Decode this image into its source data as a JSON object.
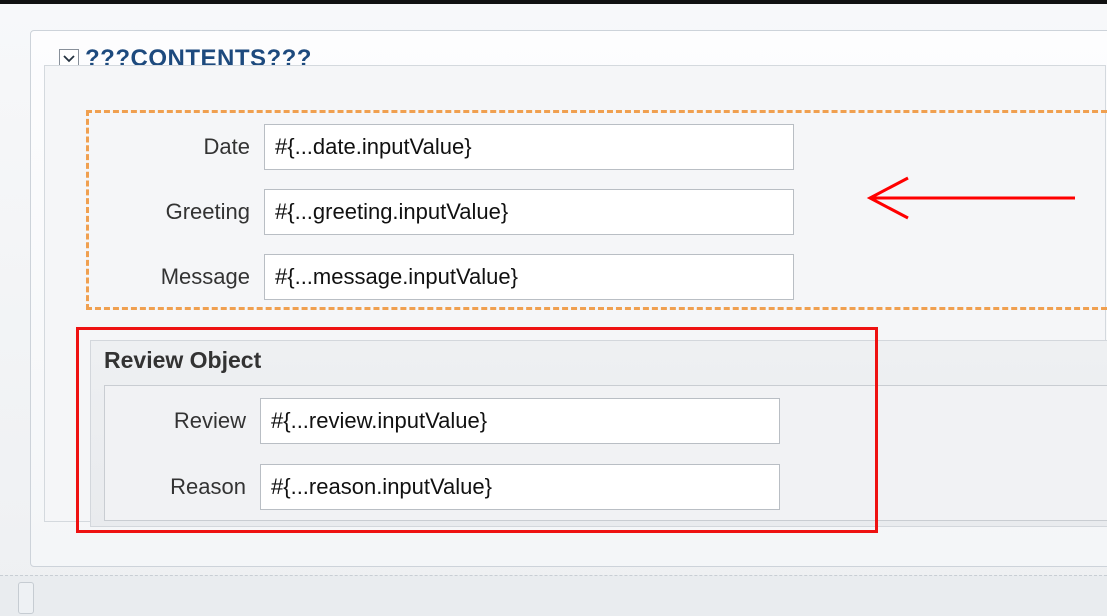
{
  "panel": {
    "title": "???CONTENTS???"
  },
  "form": {
    "fields": [
      {
        "label": "Date",
        "value": "#{...date.inputValue}"
      },
      {
        "label": "Greeting",
        "value": "#{...greeting.inputValue}"
      },
      {
        "label": "Message",
        "value": "#{...message.inputValue}"
      }
    ]
  },
  "review": {
    "title": "Review Object",
    "fields": [
      {
        "label": "Review",
        "value": "#{...review.inputValue}"
      },
      {
        "label": "Reason",
        "value": "#{...reason.inputValue}"
      }
    ]
  },
  "annotations": {
    "arrow_color": "#ff0000",
    "highlight_color": "#ff0000",
    "dotted_color": "#f0a050"
  },
  "icons": {
    "disclosure": "chevron-down-icon"
  }
}
